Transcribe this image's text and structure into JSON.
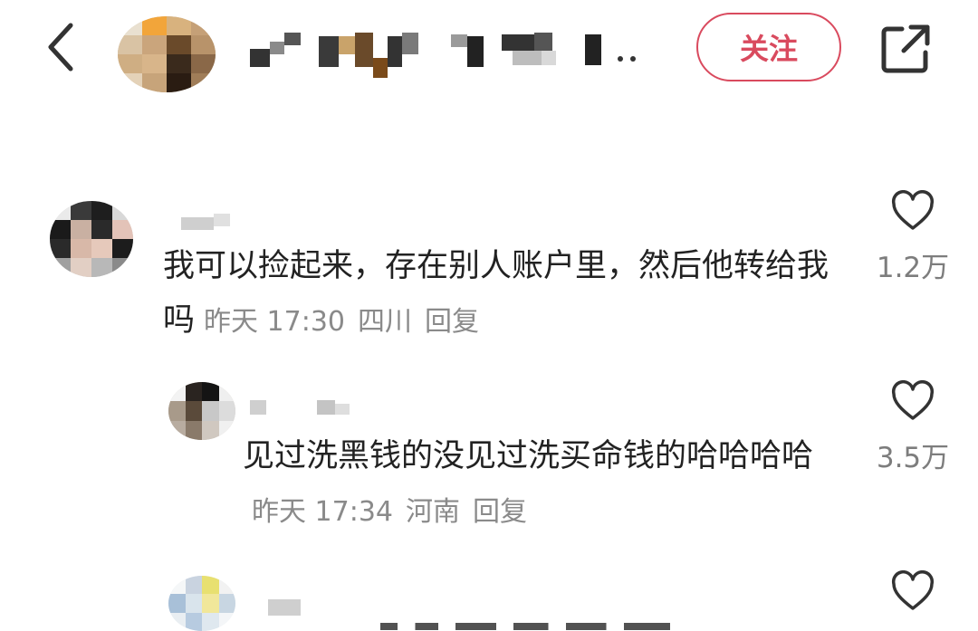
{
  "header": {
    "follow_label": "关注"
  },
  "comments": [
    {
      "text": "我可以捡起来，存在别人账户里，然后他转给我吗",
      "time": "昨天 17:30",
      "location": "四川",
      "reply_label": "回复",
      "likes": "1.2万"
    },
    {
      "text": "见过洗黑钱的没见过洗买命钱的哈哈哈哈",
      "time": "昨天 17:34",
      "location": "河南",
      "reply_label": "回复",
      "likes": "3.5万"
    }
  ],
  "icons": {
    "back": "chevron-left-icon",
    "share": "share-external-icon",
    "like": "heart-outline-icon"
  },
  "colors": {
    "accent": "#d94a5e",
    "meta_text": "#8a8a8a"
  }
}
